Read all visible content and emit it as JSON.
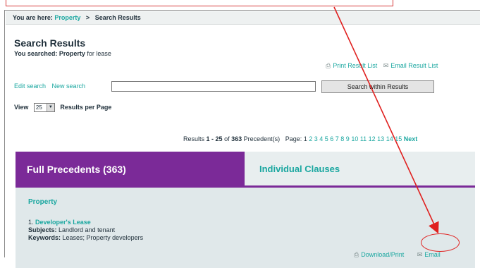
{
  "breadcrumb": {
    "prefix": "You are here:",
    "link": "Property",
    "separator": ">",
    "current": "Search Results"
  },
  "page": {
    "title": "Search Results",
    "searched_prefix": "You searched:",
    "searched_term": "Property",
    "searched_suffix": "for lease"
  },
  "result_actions": {
    "print": "Print Result List",
    "email": "Email Result List"
  },
  "search": {
    "edit": "Edit search",
    "new": "New search",
    "input_value": "",
    "button": "Search within Results"
  },
  "view": {
    "label": "View",
    "selected": "25",
    "suffix": "Results per Page"
  },
  "results_summary": {
    "prefix": "Results",
    "range": "1 - 25",
    "of": "of",
    "total": "363",
    "suffix": "Precedent(s)",
    "page_label": "Page:",
    "current_page": "1",
    "pages": "2 3 4 5 6 7 8 9 10 11 12 13 14 15",
    "next": "Next"
  },
  "tabs": [
    {
      "label": "Full Precedents (363)"
    },
    {
      "label": "Individual Clauses"
    }
  ],
  "section": {
    "title": "Property"
  },
  "entry": {
    "number": "1.",
    "title": "Developer's Lease",
    "subjects_label": "Subjects:",
    "subjects": "Landlord and tenant",
    "keywords_label": "Keywords:",
    "keywords": "Leases; Property developers",
    "download": "Download/Print",
    "email": "Email"
  },
  "colors": {
    "accent_purple": "#7b2a98",
    "link_teal": "#1aa7a0",
    "annotation_red": "#e0201f"
  }
}
